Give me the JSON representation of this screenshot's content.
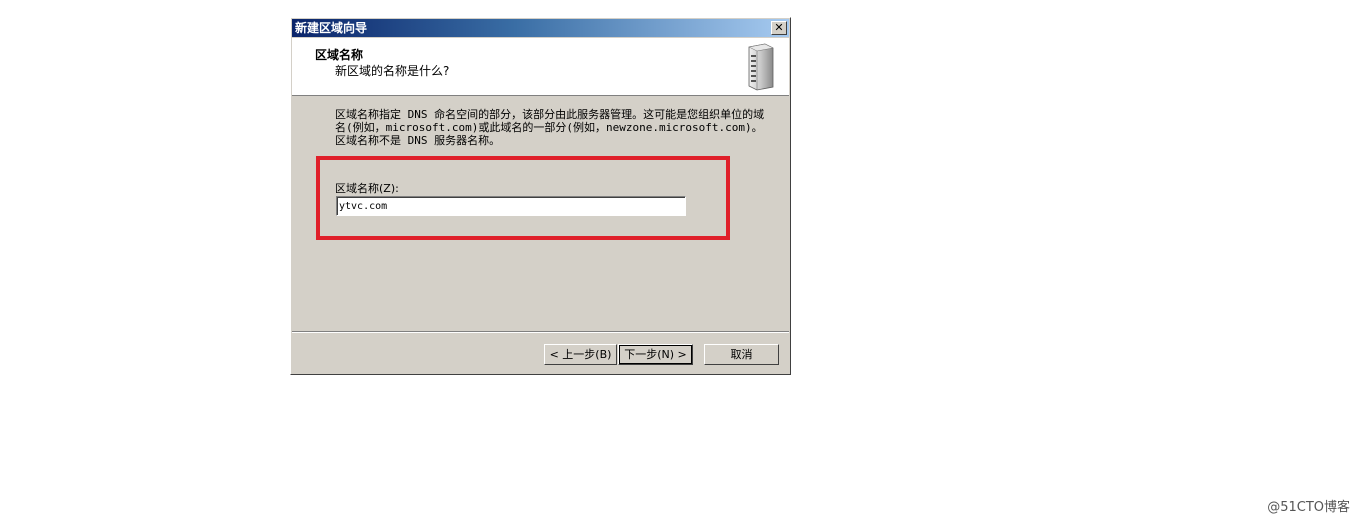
{
  "window": {
    "title": "新建区域向导",
    "close_glyph": "✕"
  },
  "header": {
    "title": "区域名称",
    "subtitle": "新区域的名称是什么?"
  },
  "description": "区域名称指定 DNS 命名空间的部分，该部分由此服务器管理。这可能是您组织单位的域名(例如，microsoft.com)或此域名的一部分(例如，newzone.microsoft.com)。区域名称不是 DNS 服务器名称。",
  "zone_field": {
    "label": "区域名称(Z):",
    "value": "ytvc.com"
  },
  "buttons": {
    "back": "< 上一步(B)",
    "next": "下一步(N) >",
    "cancel": "取消"
  },
  "highlight_color": "#e0202a",
  "watermark": "@51CTO博客"
}
